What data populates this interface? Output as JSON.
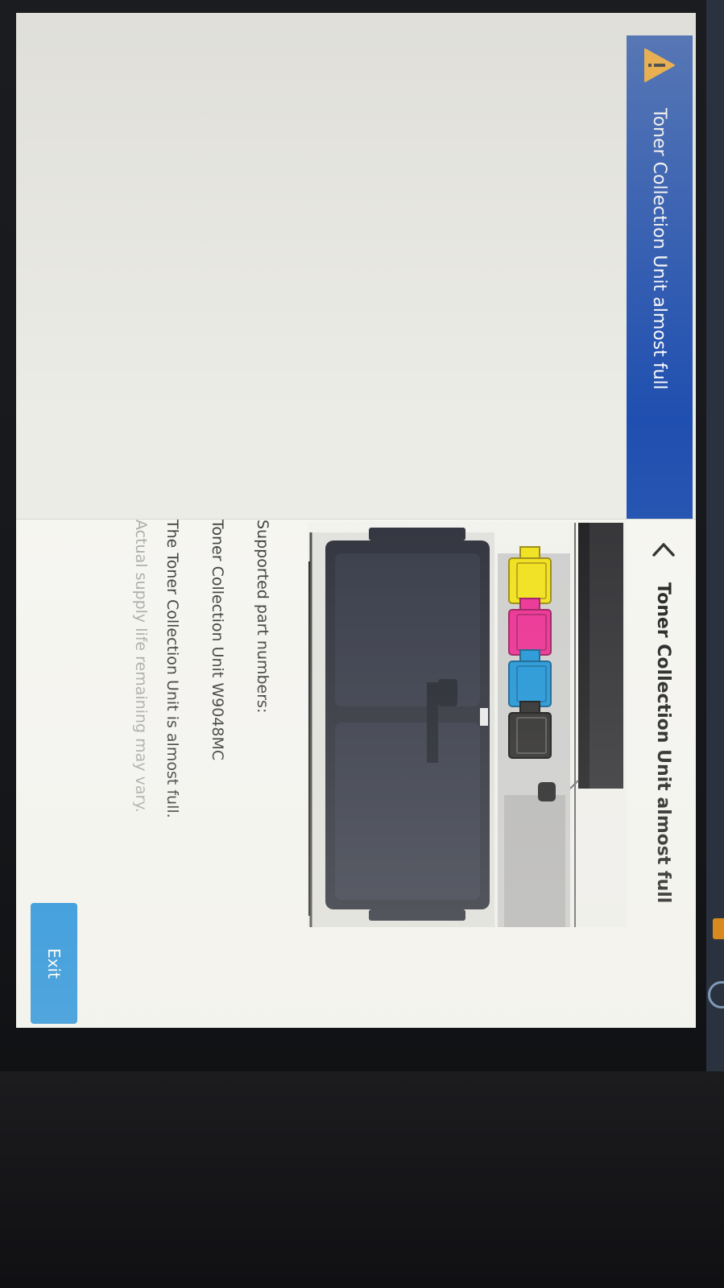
{
  "banner": {
    "title": "Toner Collection Unit almost full",
    "icon": "warning-triangle-icon",
    "color": "#1f4fb0"
  },
  "detail": {
    "title": "Toner Collection Unit almost full",
    "back_icon": "chevron-left-icon",
    "illustration": "toner-collection-unit-illustration",
    "lines": [
      "Supported part numbers:",
      "Toner Collection Unit W9048MC",
      "The Toner Collection Unit is almost full.",
      "Actual supply life remaining may vary."
    ]
  },
  "actions": {
    "exit_label": "Exit",
    "exit_color": "#1d8fdc"
  },
  "cartridge_colors": {
    "yellow": "#f2e21a",
    "magenta": "#ec2f93",
    "cyan": "#1e95d8",
    "black": "#2a2a2a"
  }
}
